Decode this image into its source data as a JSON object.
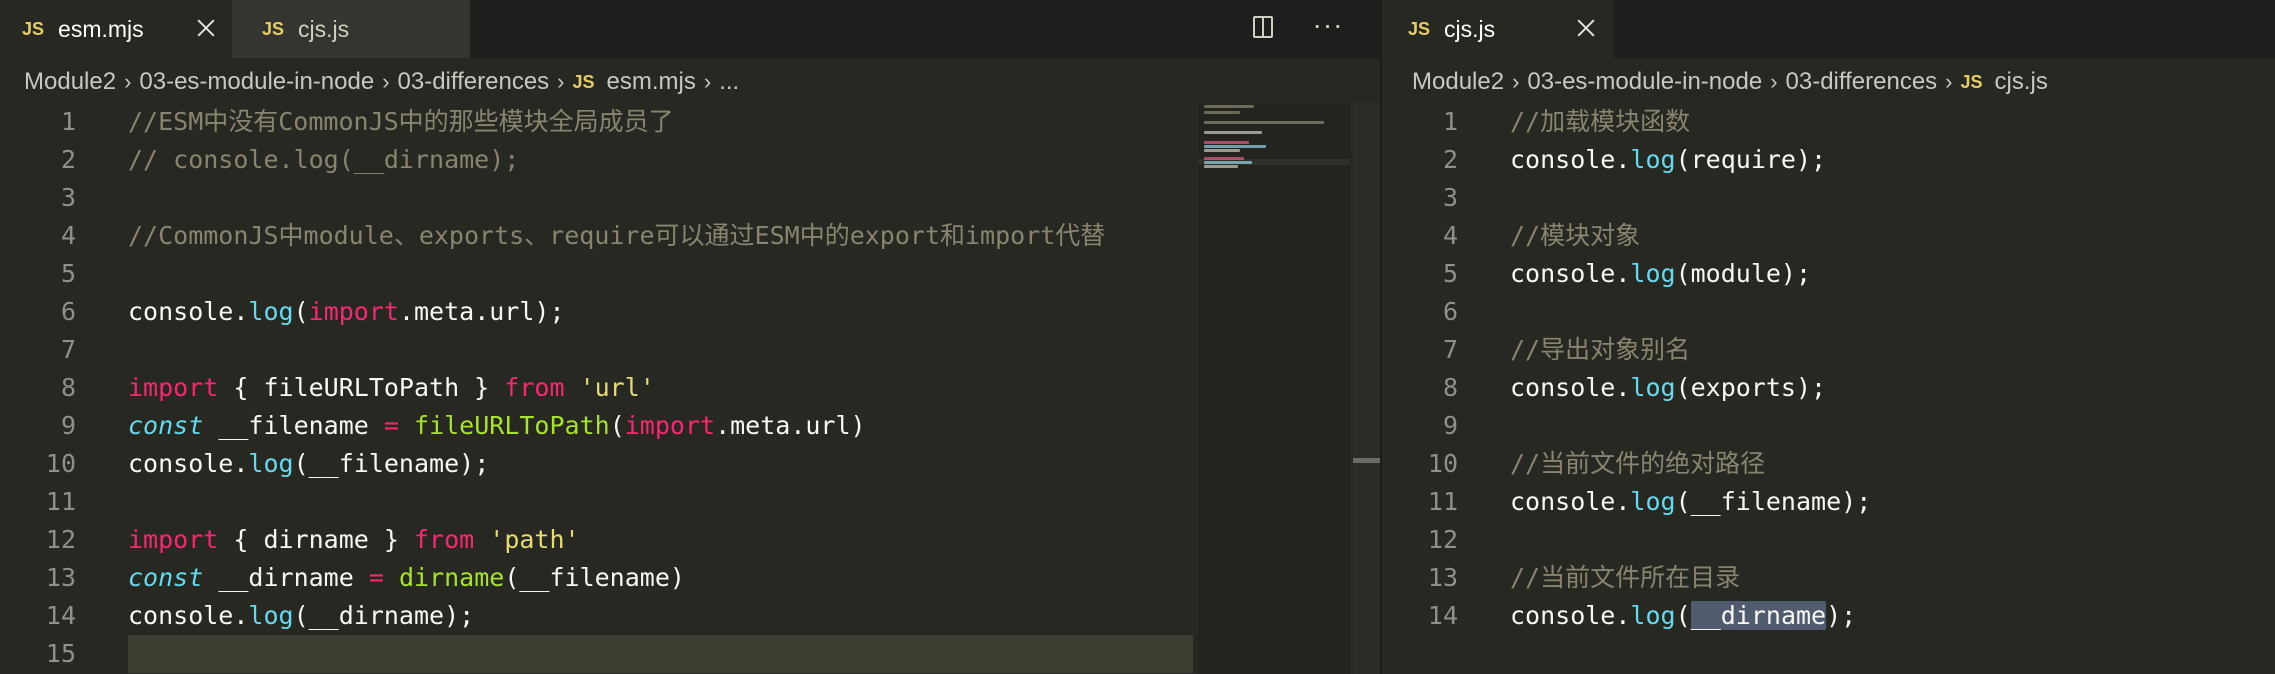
{
  "left": {
    "tabs": [
      {
        "icon": "JS",
        "label": "esm.mjs"
      },
      {
        "icon": "JS",
        "label": "cjs.js"
      }
    ],
    "breadcrumb": {
      "parts": [
        "Module2",
        "03-es-module-in-node",
        "03-differences"
      ],
      "file_icon": "JS",
      "file": "esm.mjs",
      "tail": "..."
    },
    "actions": {
      "more": "···"
    },
    "lines": [
      {
        "n": "1"
      },
      {
        "n": "2"
      },
      {
        "n": "3"
      },
      {
        "n": "4"
      },
      {
        "n": "5"
      },
      {
        "n": "6"
      },
      {
        "n": "7"
      },
      {
        "n": "8"
      },
      {
        "n": "9"
      },
      {
        "n": "10"
      },
      {
        "n": "11"
      },
      {
        "n": "12"
      },
      {
        "n": "13"
      },
      {
        "n": "14"
      },
      {
        "n": "15"
      }
    ],
    "code": {
      "l1": "//ESM中没有CommonJS中的那些模块全局成员了",
      "l2": "// console.log(__dirname);",
      "l4": "//CommonJS中module、exports、require可以通过ESM中的export和import代替",
      "l6": [
        "console",
        ".",
        "log",
        "(",
        "import",
        ".meta.url);"
      ],
      "l8": [
        "import",
        " { fileURLToPath } ",
        "from",
        " ",
        "'url'"
      ],
      "l9": [
        "const",
        " __filename ",
        "=",
        " ",
        "fileURLToPath",
        "(",
        "import",
        ".meta.url)"
      ],
      "l10": [
        "console",
        ".",
        "log",
        "(__filename);"
      ],
      "l12": [
        "import",
        " { dirname } ",
        "from",
        " ",
        "'path'"
      ],
      "l13": [
        "const",
        " __dirname ",
        "=",
        " ",
        "dirname",
        "(__filename)"
      ],
      "l14": [
        "console",
        ".",
        "log",
        "(__dirname);"
      ]
    }
  },
  "right": {
    "tabs": [
      {
        "icon": "JS",
        "label": "cjs.js"
      }
    ],
    "breadcrumb": {
      "parts": [
        "Module2",
        "03-es-module-in-node",
        "03-differences"
      ],
      "file_icon": "JS",
      "file": "cjs.js"
    },
    "lines": [
      {
        "n": "1"
      },
      {
        "n": "2"
      },
      {
        "n": "3"
      },
      {
        "n": "4"
      },
      {
        "n": "5"
      },
      {
        "n": "6"
      },
      {
        "n": "7"
      },
      {
        "n": "8"
      },
      {
        "n": "9"
      },
      {
        "n": "10"
      },
      {
        "n": "11"
      },
      {
        "n": "12"
      },
      {
        "n": "13"
      },
      {
        "n": "14"
      }
    ],
    "code": {
      "l1": "//加载模块函数",
      "l2": [
        "console",
        ".",
        "log",
        "(require);"
      ],
      "l4": "//模块对象",
      "l5": [
        "console",
        ".",
        "log",
        "(module);"
      ],
      "l7": "//导出对象别名",
      "l8": [
        "console",
        ".",
        "log",
        "(exports);"
      ],
      "l10": "//当前文件的绝对路径",
      "l11": [
        "console",
        ".",
        "log",
        "(__filename);"
      ],
      "l13": "//当前文件所在目录",
      "l14": [
        "console",
        ".",
        "log",
        "(",
        "__dirname",
        ");"
      ]
    }
  },
  "colors": {
    "background": "#272822",
    "comment": "#88846f",
    "keyword": "#f92672",
    "function": "#a6e22e",
    "string": "#e6db74",
    "storage": "#66d9ef",
    "method": "#66d9ef",
    "text": "#f8f8f2",
    "js_icon": "#e6cd69",
    "selection": "#515b70",
    "current_line": "#3e3d32"
  }
}
